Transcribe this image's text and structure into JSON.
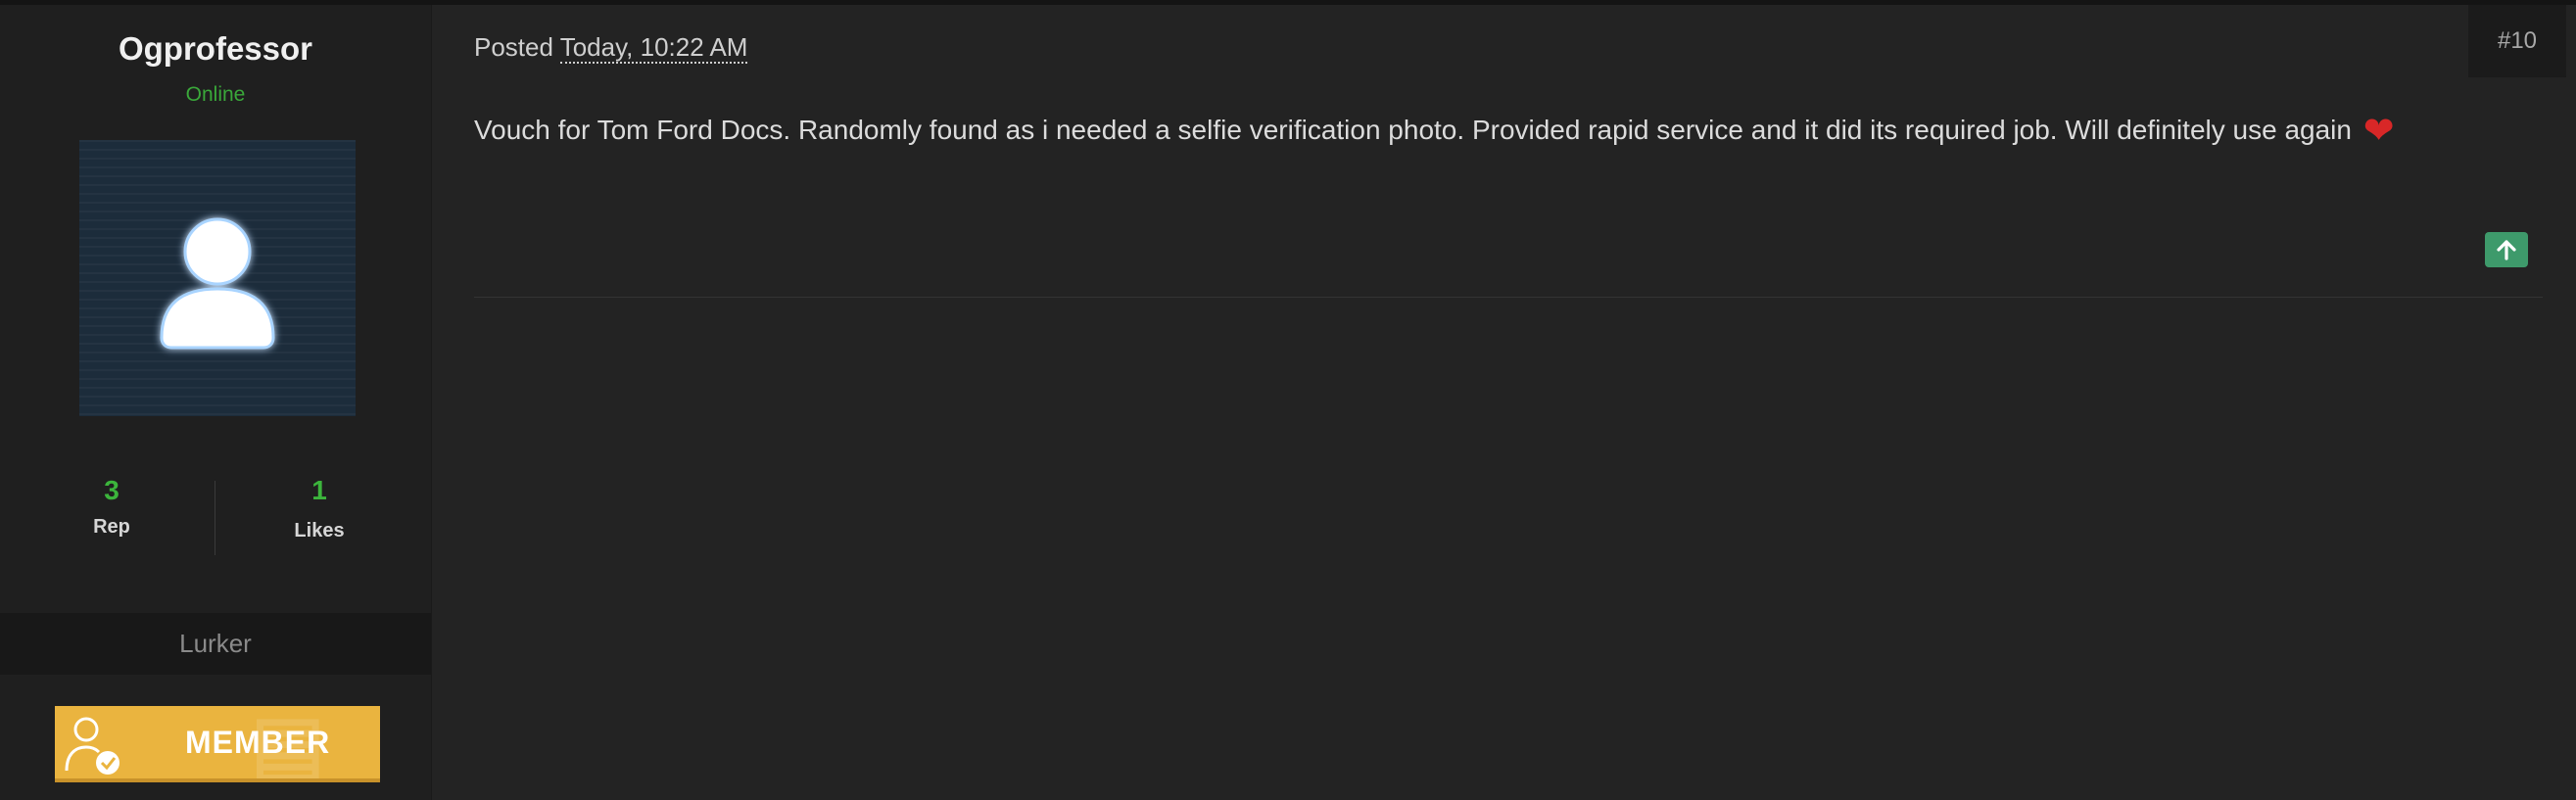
{
  "author": {
    "username": "Ogprofessor",
    "status": "Online",
    "avatar_icon": "user-silhouette-icon",
    "stats": [
      {
        "value": "3",
        "label": "Rep"
      },
      {
        "value": "1",
        "label": "Likes"
      }
    ],
    "rank": "Lurker",
    "badge": {
      "text": "MEMBER",
      "icon": "member-check-icon",
      "color": "#eab43f"
    }
  },
  "post": {
    "number": "#10",
    "posted_prefix": "Posted",
    "posted_date": "Today, 10:22 AM",
    "content": "Vouch for Tom Ford Docs. Randomly found as i needed a selfie verification photo. Provided rapid service and it did its required job. Will definitely use again",
    "emoji": "❤",
    "upvote_icon": "arrow-up-icon"
  },
  "colors": {
    "background": "#232323",
    "online": "#3aa83a",
    "stat_number": "#3cb53c",
    "upvote": "#3e9a6b"
  }
}
